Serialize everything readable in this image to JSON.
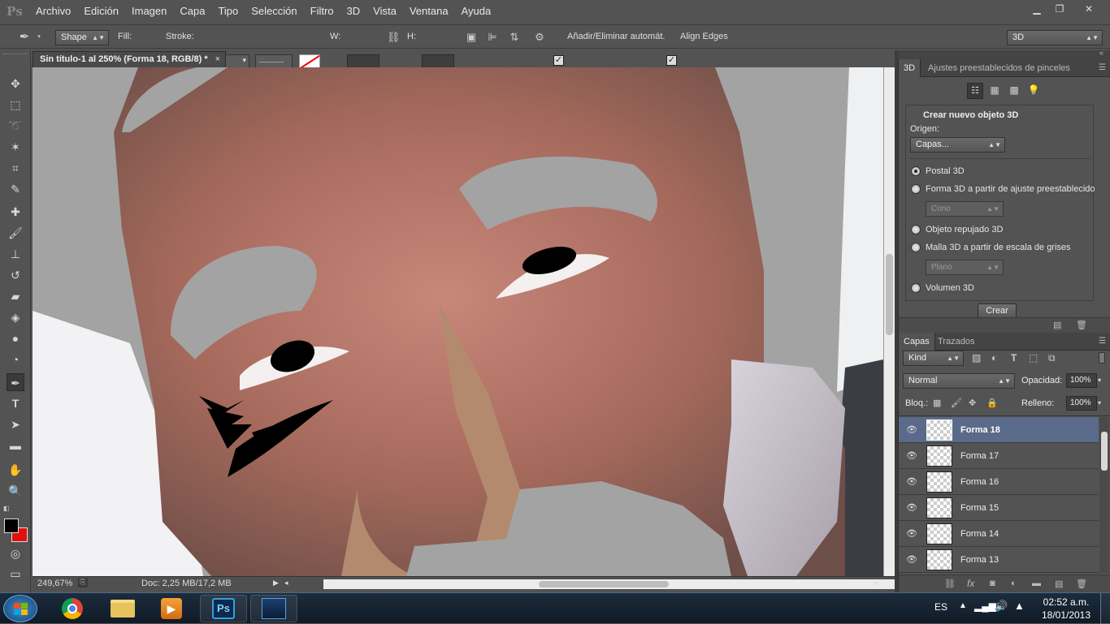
{
  "app": {
    "logo": "Ps"
  },
  "menu": [
    "Archivo",
    "Edición",
    "Imagen",
    "Capa",
    "Tipo",
    "Selección",
    "Filtro",
    "3D",
    "Vista",
    "Ventana",
    "Ayuda"
  ],
  "window_controls": {
    "minimize": "▁",
    "restore": "❐",
    "close": "✕"
  },
  "options": {
    "mode": "Shape",
    "fill_label": "Fill:",
    "fill_color": "#000000",
    "stroke_label": "Stroke:",
    "w_label": "W:",
    "h_label": "H:",
    "auto_add_delete": "Añadir/Eliminar automát.",
    "align_edges": "Align Edges",
    "workspace": "3D"
  },
  "document": {
    "tab_title": "Sin título-1 al 250% (Forma 18, RGB/8) *",
    "close": "×",
    "zoom": "249,67%",
    "doc_info": "Doc: 2,25 MB/17,2 MB"
  },
  "toolbar": {
    "tools": [
      "move-tool",
      "marquee-tool",
      "lasso-tool",
      "magic-wand-tool",
      "crop-tool",
      "eyedropper-tool",
      "healing-brush-tool",
      "brush-tool",
      "clone-stamp-tool",
      "history-brush-tool",
      "eraser-tool",
      "paint-bucket-tool",
      "blur-tool",
      "dodge-tool",
      "pen-tool",
      "type-tool",
      "path-selection-tool",
      "rectangle-tool",
      "hand-tool",
      "zoom-tool"
    ],
    "active_tool": "pen-tool",
    "foreground_color": "#000000",
    "background_color": "#e01010"
  },
  "panel3d": {
    "tabs": [
      "3D",
      "Ajustes preestablecidos de pinceles"
    ],
    "heading": "Crear nuevo objeto 3D",
    "origin_label": "Origen:",
    "origin_value": "Capas...",
    "options": [
      {
        "label": "Postal 3D",
        "selected": true
      },
      {
        "label": "Forma 3D a partir de ajuste preestablecido",
        "selected": false
      },
      {
        "label": "Objeto repujado 3D",
        "selected": false
      },
      {
        "label": "Malla 3D a partir de escala de grises",
        "selected": false
      },
      {
        "label": "Volumen 3D",
        "selected": false
      }
    ],
    "preset_shape": "Cono",
    "grayscale_mesh": "Plano",
    "create_button": "Crear"
  },
  "layers_panel": {
    "tabs": [
      "Capas",
      "Trazados"
    ],
    "filter_kind": "Kind",
    "blend_mode": "Normal",
    "opacity_label": "Opacidad:",
    "opacity": "100%",
    "lock_label": "Bloq.:",
    "fill_label": "Relleno:",
    "fill": "100%",
    "layers": [
      "Forma 18",
      "Forma 17",
      "Forma 16",
      "Forma 15",
      "Forma 14",
      "Forma 13"
    ],
    "selected_layer": "Forma 18",
    "footer_icons": [
      "link-icon",
      "fx-icon",
      "mask-icon",
      "adjustment-icon",
      "folder-icon",
      "new-layer-icon",
      "trash-icon"
    ]
  },
  "taskbar": {
    "apps": [
      "start-button",
      "chrome-icon",
      "explorer-icon",
      "media-player-icon",
      "photoshop-icon",
      "app-icon"
    ],
    "photoshop_label": "Ps",
    "language": "ES",
    "time": "02:52 a.m.",
    "date": "18/01/2013"
  }
}
